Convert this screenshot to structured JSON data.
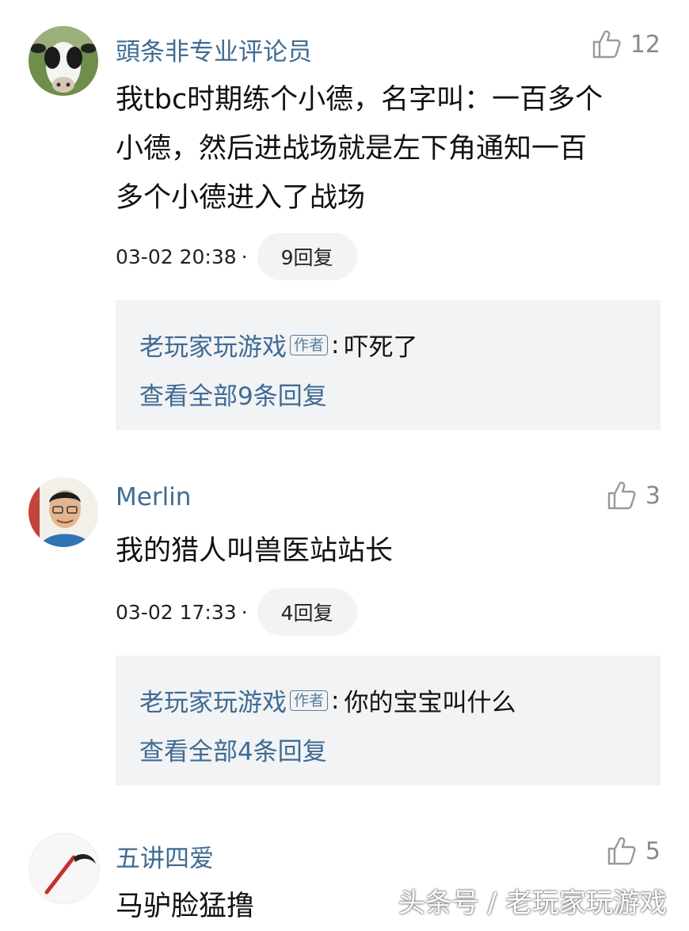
{
  "comments": [
    {
      "username": "頭条非专业评论员",
      "likes": "12",
      "text_lines": [
        "我tbc时期练个小德，名字叫：一百多个",
        "小德，然后进战场就是左下角通知一百",
        "多个小德进入了战场"
      ],
      "time": "03-02 20:38",
      "dot": "·",
      "reply_label": "9回复",
      "reply": {
        "author": "老玩家玩游戏",
        "badge": "作者",
        "colon": ":",
        "text": "吓死了",
        "view_all": "查看全部9条回复"
      }
    },
    {
      "username": "Merlin",
      "likes": "3",
      "text_lines": [
        "我的猎人叫兽医站站长"
      ],
      "time": "03-02 17:33",
      "dot": "·",
      "reply_label": "4回复",
      "reply": {
        "author": "老玩家玩游戏",
        "badge": "作者",
        "colon": ":",
        "text": "你的宝宝叫什么",
        "view_all": "查看全部4条回复"
      }
    },
    {
      "username": "五讲四爱",
      "likes": "5",
      "text_lines": [
        "马驴脸猛撸"
      ]
    }
  ],
  "watermark": "头条号 / 老玩家玩游戏",
  "icons": {
    "like": "thumbs-up-icon"
  },
  "colors": {
    "link": "#3e6b93",
    "reply_bg": "#f2f3f5",
    "muted": "#888888"
  }
}
